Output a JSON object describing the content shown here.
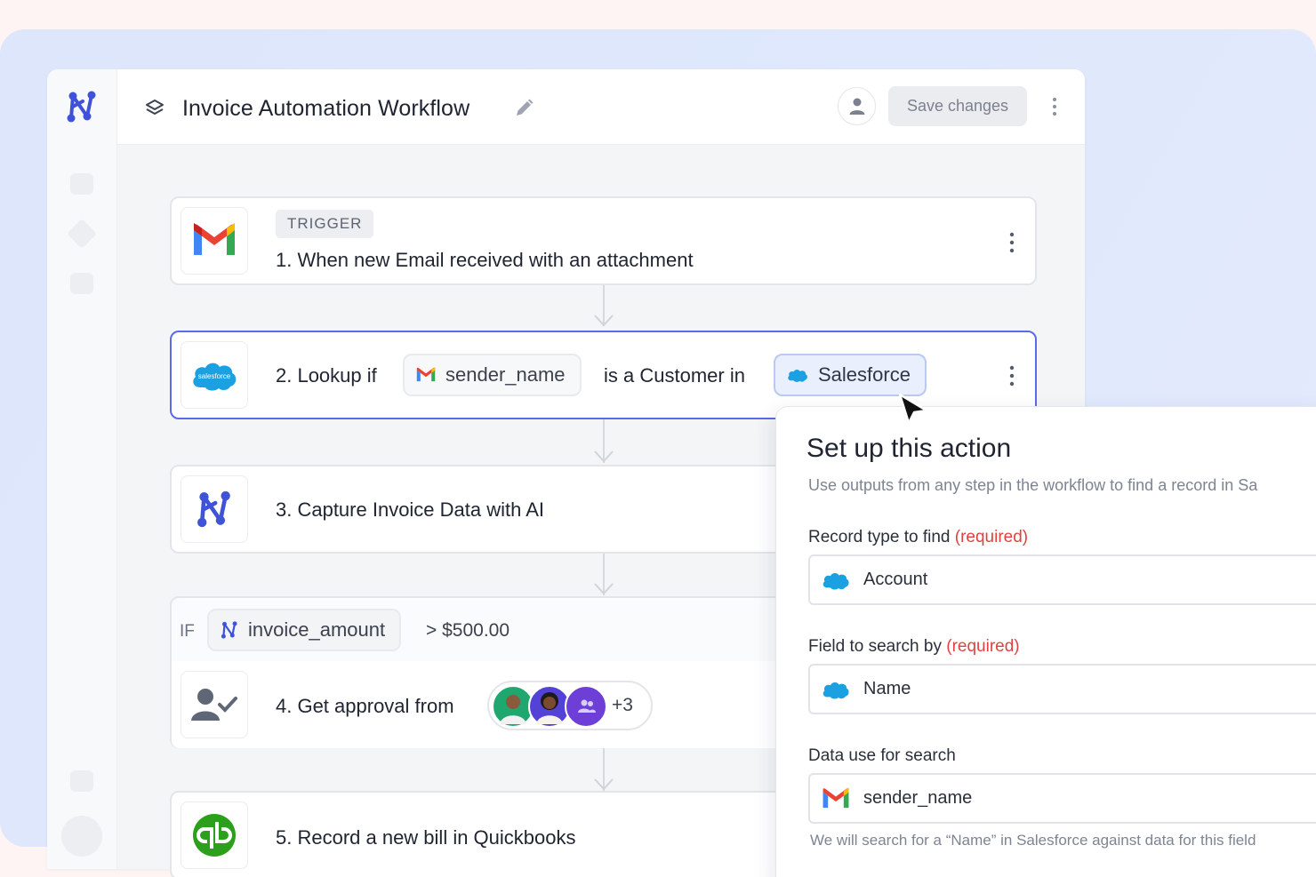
{
  "header": {
    "title": "Invoice Automation Workflow",
    "save_label": "Save changes"
  },
  "steps": [
    {
      "badge": "TRIGGER",
      "text": "1. When new Email received with an attachment",
      "icon": "gmail-icon"
    },
    {
      "text_prefix": "2. Lookup if",
      "chip_1": "sender_name",
      "text_mid": "is a Customer in",
      "chip_2": "Salesforce",
      "icon": "salesforce-icon"
    },
    {
      "text": "3. Capture Invoice Data with AI",
      "icon": "ai-logo-icon"
    },
    {
      "condition_label": "IF",
      "condition_chip": "invoice_amount",
      "condition_value": "> $500.00",
      "text": "4. Get approval from",
      "approvers_more": "+3",
      "icon": "user-check-icon"
    },
    {
      "text": "5. Record a new bill in Quickbooks",
      "icon": "quickbooks-icon"
    }
  ],
  "panel": {
    "title": "Set up this action",
    "subtitle": "Use outputs from any step in the workflow to find a record in Sa",
    "required_tag": "(required)",
    "fields": [
      {
        "label": "Record type to find",
        "required": true,
        "value": "Account",
        "icon": "salesforce-icon"
      },
      {
        "label": "Field to search by",
        "required": true,
        "value": "Name",
        "icon": "salesforce-icon"
      },
      {
        "label": "Data use for search",
        "required": false,
        "value": "sender_name",
        "icon": "gmail-icon"
      }
    ],
    "hint": "We will search for a “Name” in Salesforce against data for this field"
  },
  "colors": {
    "accent": "#4b5de3",
    "required": "#e04141",
    "salesforce": "#1ba0e2",
    "quickbooks": "#2ca01c"
  }
}
